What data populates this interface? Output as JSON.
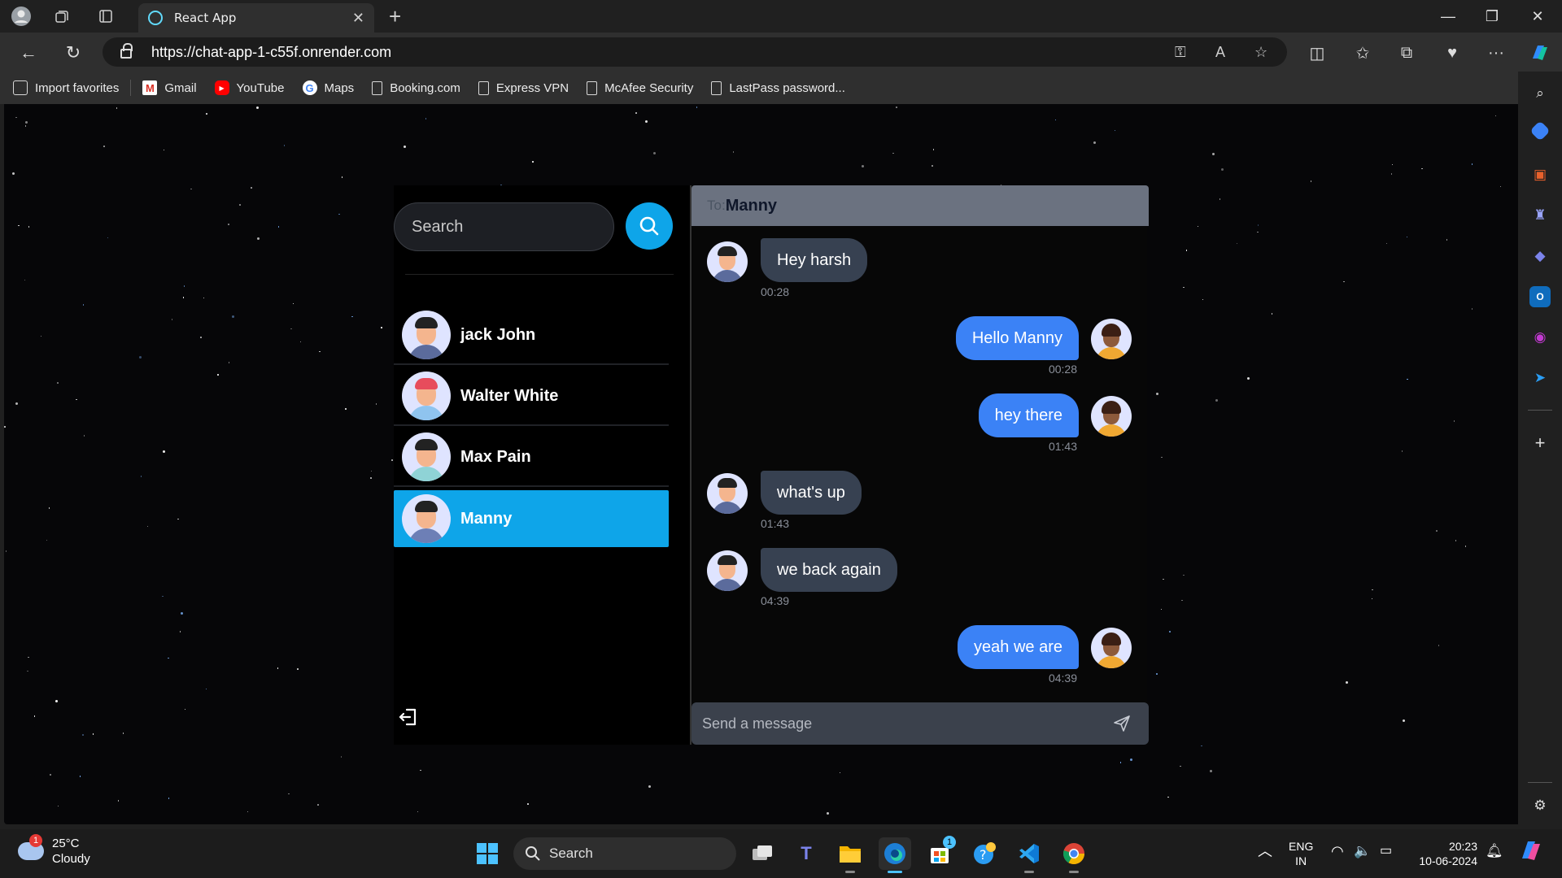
{
  "browser": {
    "tab_title": "React App",
    "url": "https://chat-app-1-c55f.onrender.com",
    "bookmarks": [
      {
        "label": "Import favorites",
        "icon": "import-icon"
      },
      {
        "label": "Gmail",
        "icon": "gmail-icon"
      },
      {
        "label": "YouTube",
        "icon": "youtube-icon"
      },
      {
        "label": "Maps",
        "icon": "maps-icon"
      },
      {
        "label": "Booking.com",
        "icon": "page-icon"
      },
      {
        "label": "Express VPN",
        "icon": "page-icon"
      },
      {
        "label": "McAfee Security",
        "icon": "page-icon"
      },
      {
        "label": "LastPass password...",
        "icon": "page-icon"
      }
    ]
  },
  "app": {
    "search_placeholder": "Search",
    "contacts": [
      {
        "name": "jack John",
        "active": false
      },
      {
        "name": "Walter White",
        "active": false
      },
      {
        "name": "Max Pain",
        "active": false
      },
      {
        "name": "Manny",
        "active": true
      }
    ],
    "chat": {
      "to_label": "To:",
      "recipient": "Manny",
      "messages": [
        {
          "text": "Hey harsh",
          "time": "00:28",
          "from": "them"
        },
        {
          "text": "Hello Manny",
          "time": "00:28",
          "from": "me"
        },
        {
          "text": "hey there",
          "time": "01:43",
          "from": "me"
        },
        {
          "text": "what's up",
          "time": "01:43",
          "from": "them"
        },
        {
          "text": "we back again",
          "time": "04:39",
          "from": "them"
        },
        {
          "text": "yeah we are",
          "time": "04:39",
          "from": "me"
        }
      ],
      "composer_placeholder": "Send a message"
    }
  },
  "taskbar": {
    "weather_temp": "25°C",
    "weather_desc": "Cloudy",
    "weather_badge": "1",
    "search_label": "Search",
    "lang_top": "ENG",
    "lang_bottom": "IN",
    "time": "20:23",
    "date": "10-06-2024",
    "store_badge": "1"
  },
  "colors": {
    "accent": "#0ea5e9",
    "outgoing_bubble": "#3b82f6",
    "incoming_bubble": "#374151",
    "header": "#6b7280"
  }
}
